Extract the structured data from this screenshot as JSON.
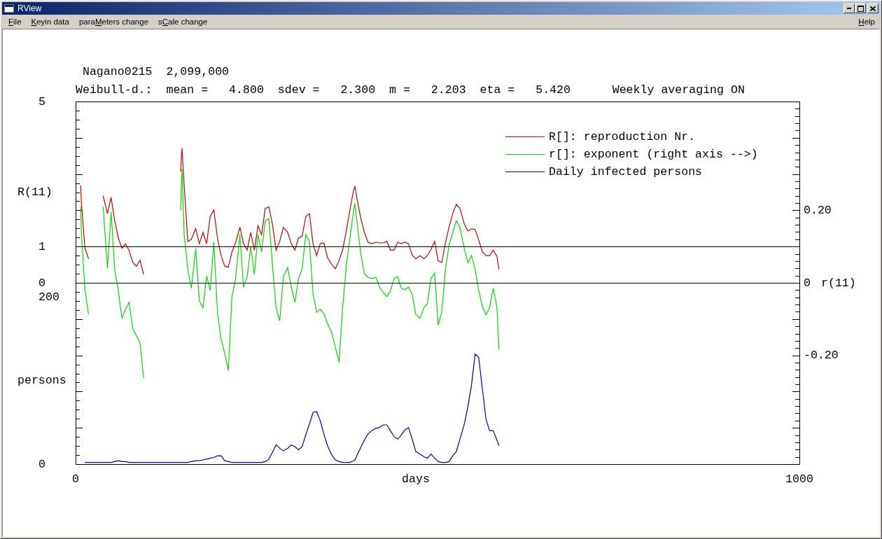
{
  "window": {
    "title": "RView"
  },
  "menu": [
    {
      "key": "F",
      "post": "ile"
    },
    {
      "key": "K",
      "post": "eyin data"
    },
    {
      "pre": "para",
      "key": "M",
      "post": "eters change"
    },
    {
      "pre": "s",
      "key": "C",
      "post": "ale change"
    }
  ],
  "help_menu": {
    "key": "H",
    "post": "elp"
  },
  "chart": {
    "dataset": "Nagano0215",
    "population": "2,099,000",
    "distribution": "Weibull-d.:",
    "params": [
      {
        "label": "mean =",
        "value": "4.800"
      },
      {
        "label": "sdev =",
        "value": "2.300"
      },
      {
        "label": "m =",
        "value": "2.203"
      },
      {
        "label": "eta =",
        "value": "5.420"
      }
    ],
    "averaging": "Weekly averaging ON",
    "chart_data": {
      "type": "line",
      "xlabel": "days",
      "xlim": [
        0,
        1000
      ],
      "xticks": [
        0,
        1000
      ],
      "ylabel": "R(11)",
      "ylim": [
        -5,
        5
      ],
      "yticks": [
        0,
        1,
        5
      ],
      "y2label": "r(11)",
      "y2lim": [
        -0.5,
        0.5
      ],
      "y2ticks": [
        {
          "value": -0.2,
          "label": "-0.20"
        },
        0,
        {
          "value": 0.2,
          "label": "0.20"
        }
      ],
      "y3label": "persons",
      "y3lim": [
        0,
        435
      ],
      "y3ticks": [
        0,
        200
      ],
      "ref_lines": [
        {
          "axis": "y",
          "value": 1
        },
        {
          "axis": "y",
          "value": 0
        }
      ],
      "legend": "upper right",
      "x": [
        7,
        8,
        13,
        18,
        23,
        28,
        33,
        38,
        44,
        49,
        54,
        59,
        64,
        69,
        74,
        79,
        84,
        89,
        94,
        99,
        105,
        110,
        115,
        120,
        125,
        130,
        135,
        140,
        145,
        147,
        150,
        155,
        160,
        166,
        171,
        176,
        181,
        186,
        191,
        196,
        201,
        206,
        211,
        216,
        221,
        227,
        232,
        237,
        242,
        247,
        252,
        257,
        262,
        267,
        272,
        277,
        282,
        287,
        293,
        298,
        303,
        308,
        313,
        318,
        323,
        328,
        333,
        338,
        343,
        348,
        354,
        359,
        364,
        369,
        374,
        379,
        384,
        386,
        389,
        394,
        399,
        404,
        409,
        415,
        420,
        425,
        430,
        435,
        440,
        445,
        450,
        455,
        460,
        465,
        470,
        476,
        481,
        486,
        491,
        496,
        501,
        506,
        511,
        516,
        521,
        526,
        531,
        537,
        542,
        547,
        552,
        557,
        562,
        567,
        572,
        577,
        582,
        585
      ],
      "series": [
        {
          "name": "R[]: reproduction Nr.",
          "color": "#cc0000",
          "values": [
            2.69,
            2.2,
            0.95,
            0.66,
            null,
            null,
            null,
            2.4,
            1.91,
            2.36,
            1.72,
            1.24,
            0.95,
            1.08,
            0.89,
            0.56,
            0.46,
            0.62,
            0.23,
            null,
            null,
            null,
            null,
            null,
            null,
            null,
            null,
            null,
            3.07,
            3.71,
            2.69,
            1.14,
            1.2,
            1.49,
            1.08,
            1.39,
            1.08,
            1.83,
            2.01,
            1.23,
            0.75,
            0.46,
            0.43,
            0.85,
            1.1,
            1.53,
            1.08,
            0.9,
            1.39,
            0.9,
            1.58,
            1.33,
            2.05,
            2.09,
            1.62,
            0.9,
            1.14,
            1.53,
            1.39,
            1.08,
            0.9,
            1.24,
            1.28,
            1.82,
            1.91,
            1.08,
            0.75,
            1.08,
            1.1,
            0.7,
            0.5,
            0.39,
            0.62,
            0.9,
            1.43,
            2.01,
            2.55,
            2.65,
            2.3,
            1.78,
            1.39,
            1.12,
            1.08,
            1.12,
            1.1,
            1.1,
            1.14,
            0.9,
            0.9,
            1.12,
            1.08,
            1.12,
            1.08,
            0.77,
            0.66,
            0.75,
            0.66,
            0.75,
            0.92,
            1.14,
            0.6,
            0.56,
            1.1,
            1.53,
            1.91,
            2.16,
            2.05,
            1.62,
            1.43,
            1.49,
            1.47,
            1.18,
            0.85,
            0.75,
            0.75,
            0.9,
            0.73,
            0.37
          ]
        },
        {
          "name": "r[]: exponent (right axis -->)",
          "color": "#00dd00",
          "axis": "y2",
          "values": [
            0.21,
            0.14,
            -0.021,
            -0.087,
            null,
            null,
            null,
            0.21,
            0.04,
            0.196,
            0.037,
            -0.021,
            -0.098,
            -0.073,
            -0.054,
            -0.127,
            -0.146,
            -0.165,
            -0.262,
            null,
            null,
            null,
            null,
            null,
            null,
            null,
            null,
            null,
            0.2,
            0.315,
            0.133,
            0.037,
            -0.015,
            0.094,
            -0.05,
            -0.069,
            0.019,
            -0.021,
            0.113,
            -0.083,
            -0.154,
            -0.194,
            -0.242,
            -0.04,
            0.012,
            0.133,
            -0.012,
            0.017,
            0.1,
            0.023,
            0.133,
            0.085,
            0.171,
            0.177,
            0.05,
            -0.069,
            -0.104,
            0.017,
            0.042,
            -0.012,
            -0.054,
            0.013,
            0.037,
            0.133,
            0.113,
            -0.031,
            -0.081,
            -0.073,
            -0.085,
            -0.112,
            -0.138,
            -0.179,
            -0.219,
            -0.069,
            0.046,
            0.123,
            0.2,
            0.219,
            0.165,
            0.081,
            0.025,
            0.015,
            0.012,
            0.015,
            -0.012,
            -0.027,
            -0.038,
            -0.023,
            0.012,
            0.017,
            -0.015,
            -0.019,
            -0.012,
            -0.031,
            -0.087,
            -0.098,
            -0.069,
            -0.058,
            0.012,
            0.027,
            -0.117,
            -0.079,
            0.037,
            0.104,
            0.137,
            0.171,
            0.152,
            0.094,
            0.056,
            0.075,
            0.037,
            -0.021,
            -0.065,
            -0.088,
            -0.069,
            -0.015,
            -0.065,
            -0.185
          ]
        },
        {
          "name": "Daily infected persons",
          "color": "#000099",
          "axis": "y3",
          "values": [
            null,
            null,
            2,
            2,
            2,
            2,
            2,
            2,
            2,
            2,
            3,
            4,
            3,
            3,
            2,
            2,
            2,
            2,
            2,
            2,
            2,
            2,
            2,
            2,
            2,
            2,
            2,
            2,
            2,
            2,
            2,
            2,
            3,
            4,
            4,
            5,
            6,
            7,
            8,
            10,
            10,
            4,
            3,
            2,
            2,
            2,
            2,
            2,
            2,
            2,
            2,
            2,
            3,
            6,
            14,
            23,
            19,
            16,
            19,
            23,
            21,
            17,
            21,
            35,
            48,
            62,
            63,
            52,
            36,
            22,
            11,
            5,
            3,
            2,
            2,
            2,
            4,
            5,
            11,
            20,
            29,
            36,
            40,
            43,
            44,
            47,
            47,
            40,
            33,
            30,
            35,
            41,
            44,
            30,
            15,
            12,
            9,
            7,
            12,
            7,
            3,
            2,
            2,
            3,
            10,
            15,
            30,
            48,
            69,
            95,
            132,
            128,
            90,
            54,
            40,
            40,
            29,
            22
          ]
        }
      ]
    }
  }
}
